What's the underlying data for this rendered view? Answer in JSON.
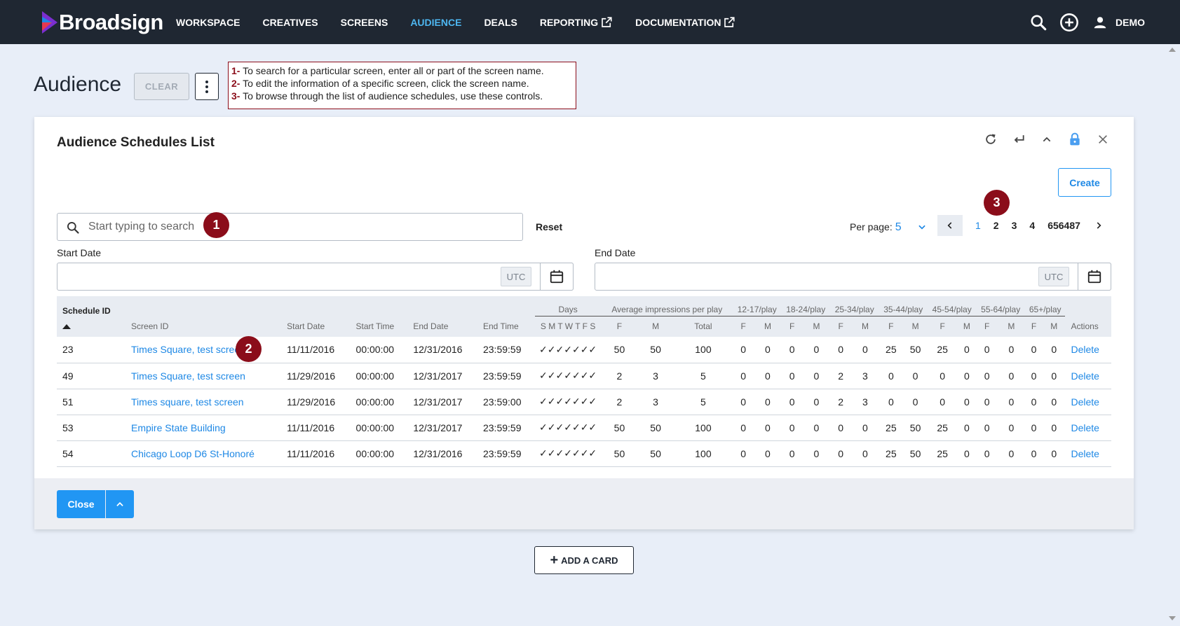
{
  "app": {
    "brand": "Broadsign",
    "nav": [
      {
        "label": "WORKSPACE"
      },
      {
        "label": "CREATIVES"
      },
      {
        "label": "SCREENS"
      },
      {
        "label": "AUDIENCE"
      },
      {
        "label": "DEALS"
      },
      {
        "label": "REPORTING"
      },
      {
        "label": "DOCUMENTATION"
      }
    ],
    "active_nav": "AUDIENCE",
    "user": "DEMO",
    "accent": "#4db6f0"
  },
  "page": {
    "title": "Audience",
    "clear_label": "CLEAR"
  },
  "annotation": {
    "lines": [
      {
        "num": "1-",
        "text": "To search for a particular screen, enter all or part of the screen name."
      },
      {
        "num": "2-",
        "text": "To edit the information of a specific screen, click the screen name."
      },
      {
        "num": "3-",
        "text": "To browse through the list of audience schedules, use these controls."
      }
    ],
    "markers": [
      "1",
      "2",
      "3"
    ],
    "color": "#8b0d1a"
  },
  "card": {
    "title": "Audience Schedules List",
    "create_label": "Create",
    "search_placeholder": "Start typing to search",
    "reset_label": "Reset",
    "per_page_label": "Per page:",
    "per_page_value": "5",
    "pages": [
      "1",
      "2",
      "3",
      "4",
      "656487"
    ],
    "current_page": "1",
    "start_date_label": "Start Date",
    "end_date_label": "End Date",
    "utc_label": "UTC",
    "close_label": "Close"
  },
  "table": {
    "headers": {
      "schedule_id": "Schedule ID",
      "screen_id": "Screen ID",
      "start_date": "Start Date",
      "start_time": "Start Time",
      "end_date": "End Date",
      "end_time": "End Time",
      "days": "Days",
      "days_sub": "S M T W T F S",
      "avg": "Average impressions per play",
      "avg_sub": [
        "F",
        "M",
        "Total"
      ],
      "groups": [
        "12-17/play",
        "18-24/play",
        "25-34/play",
        "35-44/play",
        "45-54/play",
        "55-64/play",
        "65+/play"
      ],
      "group_sub": [
        "F",
        "M"
      ],
      "actions": "Actions"
    },
    "rows": [
      {
        "id": "23",
        "screen": "Times Square, test screen",
        "start_date": "11/11/2016",
        "start_time": "00:00:00",
        "end_date": "12/31/2016",
        "end_time": "23:59:59",
        "days": "✓✓✓✓✓✓✓",
        "avg": [
          "50",
          "50",
          "100"
        ],
        "groups": [
          "0",
          "0",
          "0",
          "0",
          "0",
          "0",
          "25",
          "50",
          "25",
          "0",
          "0",
          "0",
          "0",
          "0"
        ],
        "action": "Delete"
      },
      {
        "id": "49",
        "screen": "Times Square, test screen",
        "start_date": "11/29/2016",
        "start_time": "00:00:00",
        "end_date": "12/31/2017",
        "end_time": "23:59:59",
        "days": "✓✓✓✓✓✓✓",
        "avg": [
          "2",
          "3",
          "5"
        ],
        "groups": [
          "0",
          "0",
          "0",
          "0",
          "2",
          "3",
          "0",
          "0",
          "0",
          "0",
          "0",
          "0",
          "0",
          "0"
        ],
        "action": "Delete"
      },
      {
        "id": "51",
        "screen": "Times square, test screen",
        "start_date": "11/29/2016",
        "start_time": "00:00:00",
        "end_date": "12/31/2017",
        "end_time": "23:59:00",
        "days": "✓✓✓✓✓✓✓",
        "avg": [
          "2",
          "3",
          "5"
        ],
        "groups": [
          "0",
          "0",
          "0",
          "0",
          "2",
          "3",
          "0",
          "0",
          "0",
          "0",
          "0",
          "0",
          "0",
          "0"
        ],
        "action": "Delete"
      },
      {
        "id": "53",
        "screen": "Empire State Building",
        "start_date": "11/11/2016",
        "start_time": "00:00:00",
        "end_date": "12/31/2017",
        "end_time": "23:59:59",
        "days": "✓✓✓✓✓✓✓",
        "avg": [
          "50",
          "50",
          "100"
        ],
        "groups": [
          "0",
          "0",
          "0",
          "0",
          "0",
          "0",
          "25",
          "50",
          "25",
          "0",
          "0",
          "0",
          "0",
          "0"
        ],
        "action": "Delete"
      },
      {
        "id": "54",
        "screen": "Chicago Loop D6 St-Honoré",
        "start_date": "11/11/2016",
        "start_time": "00:00:00",
        "end_date": "12/31/2016",
        "end_time": "23:59:59",
        "days": "✓✓✓✓✓✓✓",
        "avg": [
          "50",
          "50",
          "100"
        ],
        "groups": [
          "0",
          "0",
          "0",
          "0",
          "0",
          "0",
          "25",
          "50",
          "25",
          "0",
          "0",
          "0",
          "0",
          "0"
        ],
        "action": "Delete"
      }
    ]
  },
  "add_card_label": "ADD A CARD"
}
